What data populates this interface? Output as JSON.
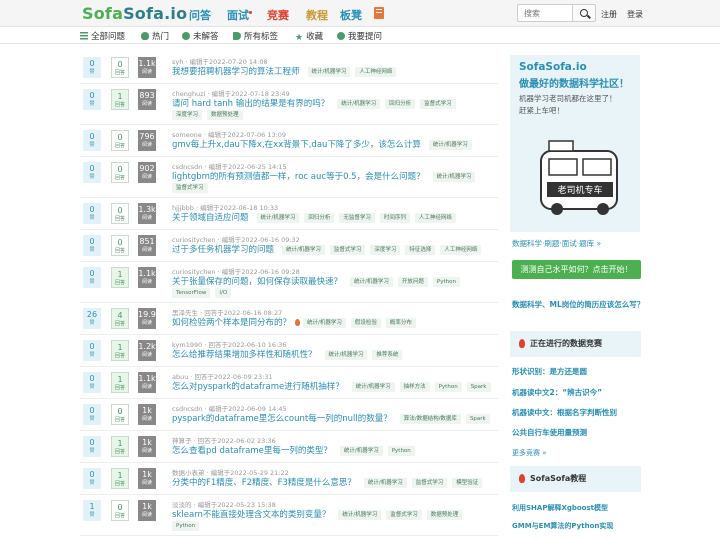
{
  "header": {
    "logo_part1": "Sofa",
    "logo_part2": "Sofa",
    "logo_suffix": ".io",
    "nav": [
      "问答",
      "面试",
      "竞赛",
      "教程",
      "板凳"
    ],
    "search_placeholder": "搜索",
    "register": "注册",
    "login": "登录"
  },
  "subnav": {
    "tabs": [
      "全部问题",
      "热门",
      "未解答",
      "所有标签",
      "收藏",
      "我要提问"
    ]
  },
  "questions": [
    {
      "votes": "0",
      "vote_label": "赞",
      "answers": "0",
      "answer_label": "回答",
      "views": "1.1k",
      "view_label": "阅读",
      "meta": "syh · 编辑于2022-07-20 14:08",
      "title": "我想要招聘机器学习的算法工程师",
      "tags": [
        "统计/机器学习",
        "人工神经网络"
      ],
      "tags2": []
    },
    {
      "votes": "0",
      "vote_label": "赞",
      "answers": "1",
      "answer_label": "回答",
      "views": "893",
      "view_label": "阅读",
      "meta": "chenghuzi · 编辑于2022-07-18 23:49",
      "title": "请问 hard tanh 输出的结果是有界的吗？",
      "tags": [
        "统计/机器学习",
        "回归分析",
        "监督式学习"
      ],
      "tags2": [
        "深度学习",
        "数据预处理"
      ]
    },
    {
      "votes": "0",
      "vote_label": "赞",
      "answers": "0",
      "answer_label": "回答",
      "views": "796",
      "view_label": "阅读",
      "meta": "someone · 编辑于2022-07-06 13:09",
      "title": "gmv每上升x,dau下降x,在xx背景下,dau下降了多少，该怎么计算",
      "tags": [
        "统计/机器学习"
      ],
      "tags2": []
    },
    {
      "votes": "0",
      "vote_label": "赞",
      "answers": "0",
      "answer_label": "回答",
      "views": "902",
      "view_label": "阅读",
      "meta": "csdncsdn · 编辑于2022-06-25 14:15",
      "title": "lightgbm的所有预测值都一样，roc auc等于0.5，会是什么问题？",
      "tags": [
        "统计/机器学习"
      ],
      "tags2": [
        "监督式学习"
      ]
    },
    {
      "votes": "0",
      "vote_label": "赞",
      "answers": "0",
      "answer_label": "回答",
      "views": "1.3k",
      "view_label": "阅读",
      "meta": "hjjjbbb · 编辑于2022-06-18 10:33",
      "title": "关于领域自适应问题",
      "tags": [
        "统计/机器学习",
        "回归分析",
        "无监督学习",
        "时间序列",
        "人工神经网络"
      ],
      "tags2": []
    },
    {
      "votes": "0",
      "vote_label": "赞",
      "answers": "0",
      "answer_label": "回答",
      "views": "851",
      "view_label": "阅读",
      "meta": "curiositychen · 编辑于2022-06-16 09:32",
      "title": "过于多任务机器学习的问题",
      "tags": [
        "统计/机器学习",
        "监督式学习",
        "深度学习",
        "特征选择",
        "人工神经网络"
      ],
      "tags2": []
    },
    {
      "votes": "0",
      "vote_label": "赞",
      "answers": "1",
      "answer_label": "回答",
      "views": "1.1k",
      "view_label": "阅读",
      "meta": "curiositychen · 编辑于2022-06-16 09:28",
      "title": "关于张量保存的问题，如何保存读取最快速？",
      "tags": [
        "统计/机器学习",
        "开放问题",
        "Python"
      ],
      "tags2": [
        "TensorFlow",
        "I/O"
      ]
    },
    {
      "votes": "26",
      "vote_label": "赞",
      "answers": "4",
      "answer_label": "回答",
      "views": "19.9k",
      "view_label": "阅读",
      "meta": "黑泽先生 · 回答于2022-06-16 08:27",
      "title": "如何检验两个样本是同分布的？",
      "hot": true,
      "tags": [
        "统计/机器学习",
        "假设检验",
        "概率分布"
      ],
      "tags2": []
    },
    {
      "votes": "0",
      "vote_label": "赞",
      "answers": "1",
      "answer_label": "回答",
      "views": "1.2k",
      "view_label": "阅读",
      "meta": "kym1990 · 回答于2022-06-10 16:36",
      "title": "怎么给推荐结果增加多样性和随机性？",
      "tags": [
        "统计/机器学习",
        "推荐系统"
      ],
      "tags2": []
    },
    {
      "votes": "0",
      "vote_label": "赞",
      "answers": "1",
      "answer_label": "回答",
      "views": "1.1k",
      "view_label": "阅读",
      "meta": "abuu · 回答于2022-06-09 23:31",
      "title": "怎么对pyspark的dataframe进行随机抽样？",
      "tags": [
        "统计/机器学习",
        "抽样方法",
        "Python",
        "Spark"
      ],
      "tags2": []
    },
    {
      "votes": "0",
      "vote_label": "赞",
      "answers": "0",
      "answer_label": "回答",
      "views": "1k",
      "view_label": "阅读",
      "meta": "csdncsdn · 编辑于2022-06-09 14:45",
      "title": "pyspark的dataframe里怎么count每一列的null的数量？",
      "tags": [
        "算法/数据结构/数据库",
        "Spark"
      ],
      "tags2": []
    },
    {
      "votes": "0",
      "vote_label": "赞",
      "answers": "1",
      "answer_label": "回答",
      "views": "1k",
      "view_label": "阅读",
      "meta": "神算子 · 回答于2022-06-02 23:36",
      "title": "怎么查看pd dataframe里每一列的类型？",
      "tags": [
        "统计/机器学习",
        "Python"
      ],
      "tags2": []
    },
    {
      "votes": "0",
      "vote_label": "赞",
      "answers": "1",
      "answer_label": "回答",
      "views": "1k",
      "view_label": "阅读",
      "meta": "数据小表弟 · 编辑于2022-05-29 21:22",
      "title": "分类中的F1精度、F2精度、F3精度是什么意思？",
      "tags": [
        "统计/机器学习",
        "监督式学习",
        "模型验证"
      ],
      "tags2": []
    },
    {
      "votes": "1",
      "vote_label": "赞",
      "answers": "0",
      "answer_label": "回答",
      "views": "1k",
      "view_label": "阅读",
      "meta": "淡淡的 · 编辑于2022-05-23 15:38",
      "title": "sklearn不能直接处理含文本的类别变量？",
      "tags": [
        "统计/机器学习",
        "监督式学习",
        "数据预处理"
      ],
      "tags2": [
        "Python"
      ]
    }
  ],
  "sidebar": {
    "brand": "SofaSofa.io",
    "slogan": "做最好的数据科学社区！",
    "line1": "机器学习老司机都在这里了！",
    "line2": "赶紧上车吧！",
    "bus_sign": "老司机专车",
    "link_features": "数据科学·刷题·面试·题库 »",
    "test_button": "测测自己水平如何？点击开始！",
    "post_link": "数据科学、ML岗位的简历应该怎么写？",
    "contest_header": "正在进行的数据竞赛",
    "contests": [
      "形状识别：是方还是圆",
      "机器读中文2：“辨古识今”",
      "机器读中文：根据名字判断性别",
      "公共自行车使用量预测"
    ],
    "more_contests": "更多竞赛 »",
    "tutorial_header": "SofaSofa教程",
    "tutorials": [
      "利用SHAP解释Xgboost模型",
      "GMM与EM算法的Python实现"
    ]
  }
}
